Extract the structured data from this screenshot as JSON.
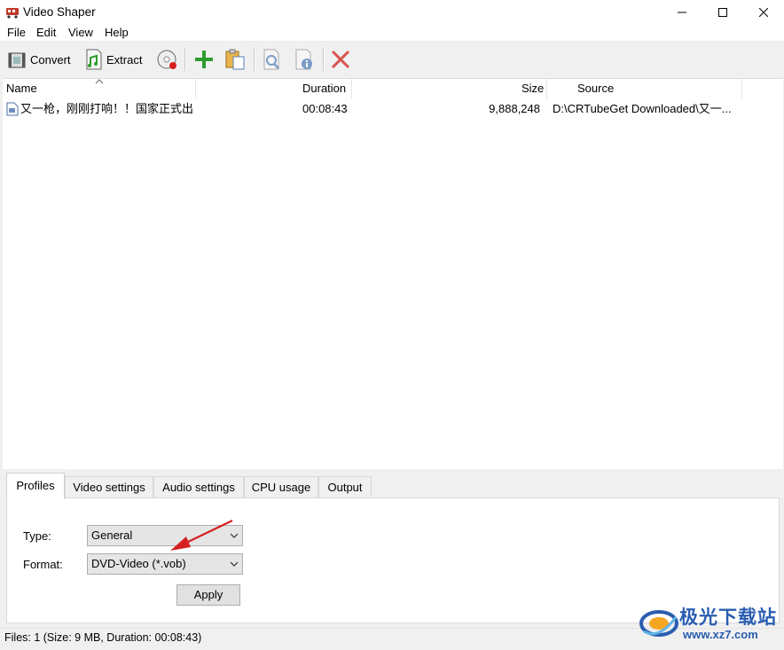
{
  "window": {
    "title": "Video Shaper"
  },
  "menu": {
    "items": [
      "File",
      "Edit",
      "View",
      "Help"
    ]
  },
  "toolbar": {
    "convert_label": "Convert",
    "extract_label": "Extract"
  },
  "list": {
    "columns": {
      "name": "Name",
      "duration": "Duration",
      "size": "Size",
      "source": "Source"
    },
    "rows": [
      {
        "name": "又一枪，刚刚打响！！国家正式出...",
        "duration": "00:08:43",
        "size": "9,888,248",
        "source": "D:\\CRTubeGet Downloaded\\又一..."
      }
    ]
  },
  "tabs": [
    "Profiles",
    "Video settings",
    "Audio settings",
    "CPU usage",
    "Output"
  ],
  "profiles": {
    "type_label": "Type:",
    "type_value": "General",
    "format_label": "Format:",
    "format_value": "DVD-Video (*.vob)",
    "apply_label": "Apply"
  },
  "status": {
    "text": "Files: 1 (Size: 9 MB, Duration: 00:08:43)"
  },
  "watermark": {
    "line1": "极光下载站",
    "line2": "www.xz7.com"
  },
  "colors": {
    "add_green": "#2e9d2e",
    "delete_red": "#d9534f",
    "annotation_arrow": "#d62020",
    "watermark_blue": "#2a5db0"
  }
}
